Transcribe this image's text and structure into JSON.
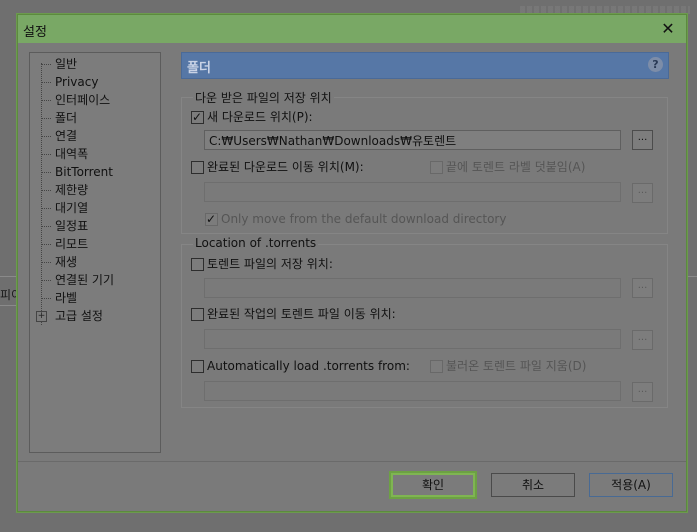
{
  "dialog": {
    "title": "설정",
    "close_glyph": "✕"
  },
  "background": {
    "side_label": "피이"
  },
  "sidebar": {
    "items": [
      {
        "label": "일반"
      },
      {
        "label": "Privacy"
      },
      {
        "label": "인터페이스"
      },
      {
        "label": "폴더"
      },
      {
        "label": "연결"
      },
      {
        "label": "대역폭"
      },
      {
        "label": "BitTorrent"
      },
      {
        "label": "제한량"
      },
      {
        "label": "대기열"
      },
      {
        "label": "일정표"
      },
      {
        "label": "리모트"
      },
      {
        "label": "재생"
      },
      {
        "label": "연결된 기기"
      },
      {
        "label": "라벨"
      },
      {
        "label": "고급 설정",
        "expander": "+"
      }
    ]
  },
  "panel": {
    "title": "폴더",
    "help_glyph": "?",
    "downloaded_group": {
      "label": "다운 받은 파일의 저장 위치",
      "new_download": {
        "label": "새 다운로드 위치(P):",
        "checked": true,
        "path": "C:₩Users₩Nathan₩Downloads₩유토렌트"
      },
      "move_completed": {
        "label": "완료된 다운로드 이동 위치(M):",
        "checked": false,
        "path": ""
      },
      "append_label": {
        "label": "끝에 토렌트 라벨 덧붙임(A)",
        "checked": false
      },
      "only_move_default": {
        "label": "Only move from the default download directory",
        "checked": true
      }
    },
    "torrents_group": {
      "label": "Location of .torrents",
      "store_torrents": {
        "label": "토렌트 파일의 저장 위치:",
        "checked": false,
        "path": ""
      },
      "move_finished": {
        "label": "완료된 작업의 토렌트 파일 이동 위치:",
        "checked": false,
        "path": ""
      },
      "auto_load": {
        "label": "Automatically load .torrents from:",
        "checked": false,
        "path": ""
      },
      "delete_loaded": {
        "label": "불러온 토렌트 파일 지움(D)",
        "checked": false
      }
    },
    "browse_glyph": "..."
  },
  "footer": {
    "ok_label": "확인",
    "cancel_label": "취소",
    "apply_label": "적용(A)"
  }
}
